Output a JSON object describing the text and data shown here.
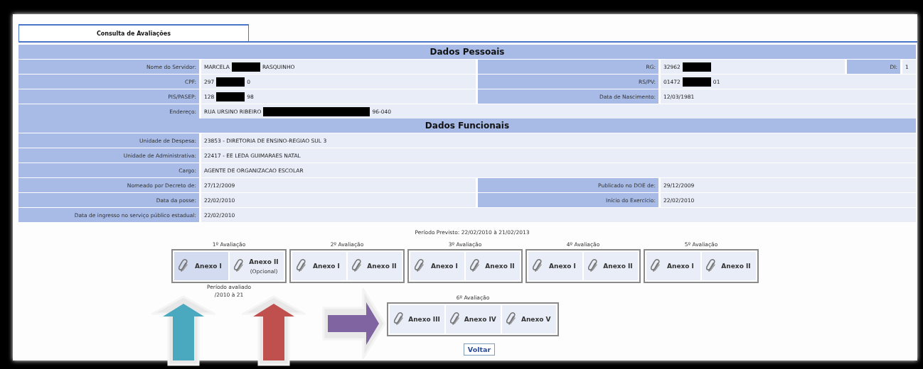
{
  "tab": {
    "label": "Consulta de Avaliações",
    "selected": true
  },
  "sections": [
    {
      "title": "Dados Pessoais",
      "rows": [
        {
          "fields": [
            {
              "label": "Nome do Servidor:",
              "segments": [
                {
                  "kind": "text",
                  "text": "MARCELA"
                },
                {
                  "kind": "redaction"
                },
                {
                  "kind": "text",
                  "text": "RASQUINHO"
                }
              ]
            },
            {
              "label": "RG:",
              "segments": [
                {
                  "kind": "text",
                  "text": "32962"
                },
                {
                  "kind": "redaction"
                }
              ]
            },
            {
              "label": "DI:",
              "segments": [
                {
                  "kind": "text",
                  "text": "1"
                }
              ]
            }
          ]
        },
        {
          "fields": [
            {
              "label": "CPF:",
              "segments": [
                {
                  "kind": "text",
                  "text": "297"
                },
                {
                  "kind": "redaction"
                },
                {
                  "kind": "text",
                  "text": "0"
                }
              ]
            },
            {
              "label": "RS/PV:",
              "segments": [
                {
                  "kind": "text",
                  "text": "01472"
                },
                {
                  "kind": "redaction"
                },
                {
                  "kind": "text",
                  "text": "01"
                }
              ]
            }
          ]
        },
        {
          "fields": [
            {
              "label": "PIS/PASEP:",
              "segments": [
                {
                  "kind": "text",
                  "text": "128"
                },
                {
                  "kind": "redaction"
                },
                {
                  "kind": "text",
                  "text": "98"
                }
              ]
            },
            {
              "label": "Data de Nascimento:",
              "segments": [
                {
                  "kind": "text",
                  "text": "12/03/1981"
                }
              ]
            }
          ]
        },
        {
          "fields": [
            {
              "label": "Endereço:",
              "segments": [
                {
                  "kind": "text",
                  "text": "RUA URSINO RIBEIRO"
                },
                {
                  "kind": "redaction"
                },
                {
                  "kind": "text",
                  "text": "96-040"
                }
              ]
            }
          ]
        }
      ]
    },
    {
      "title": "Dados Funcionais",
      "rows": [
        {
          "fields": [
            {
              "label": "Unidade de Despesa:",
              "segments": [
                {
                  "kind": "text",
                  "text": "23853 - DIRETORIA DE ENSINO-REGIAO SUL 3"
                }
              ]
            }
          ]
        },
        {
          "fields": [
            {
              "label": "Unidade de Administrativa:",
              "segments": [
                {
                  "kind": "text",
                  "text": "22417 - EE LEDA GUIMARAES NATAL"
                }
              ]
            }
          ]
        },
        {
          "fields": [
            {
              "label": "Cargo:",
              "segments": [
                {
                  "kind": "text",
                  "text": "AGENTE DE ORGANIZACAO ESCOLAR"
                }
              ]
            }
          ]
        },
        {
          "fields": [
            {
              "label": "Nomeado por Decreto de:",
              "segments": [
                {
                  "kind": "text",
                  "text": "27/12/2009"
                }
              ]
            },
            {
              "label": "Publicado no DOE de:",
              "segments": [
                {
                  "kind": "text",
                  "text": "29/12/2009"
                }
              ]
            }
          ]
        },
        {
          "fields": [
            {
              "label": "Data da posse:",
              "segments": [
                {
                  "kind": "text",
                  "text": "22/02/2010"
                }
              ]
            },
            {
              "label": "Início do Exercício:",
              "segments": [
                {
                  "kind": "text",
                  "text": "22/02/2010"
                }
              ]
            }
          ]
        },
        {
          "fields": [
            {
              "label": "Data de ingresso no serviço público estadual:",
              "segments": [
                {
                  "kind": "text",
                  "text": "22/02/2010"
                }
              ]
            }
          ]
        }
      ]
    }
  ],
  "period": "Período Previsto: 22/02/2010 à 21/02/2013",
  "evaluation_rows": [
    {
      "groups": [
        {
          "title": "1º Avaliação",
          "items": [
            {
              "label": "Anexo I",
              "selected": true
            },
            {
              "label": "Anexo II",
              "note": "(Opcional)",
              "selected": false
            }
          ],
          "caption": [
            "Período avaliado",
            "/2010 à 21"
          ]
        },
        {
          "title": "2º Avaliação",
          "items": [
            {
              "label": "Anexo I",
              "selected": false
            },
            {
              "label": "Anexo II",
              "selected": false
            }
          ]
        },
        {
          "title": "3º Avaliação",
          "items": [
            {
              "label": "Anexo I",
              "selected": false
            },
            {
              "label": "Anexo II",
              "selected": false
            }
          ]
        },
        {
          "title": "4º Avaliação",
          "items": [
            {
              "label": "Anexo I",
              "selected": false
            },
            {
              "label": "Anexo II",
              "selected": false
            }
          ]
        },
        {
          "title": "5º Avaliação",
          "items": [
            {
              "label": "Anexo I",
              "selected": false
            },
            {
              "label": "Anexo II",
              "selected": false
            }
          ]
        }
      ]
    },
    {
      "groups": [
        {
          "title": "6º Avaliação",
          "items": [
            {
              "label": "Anexo III",
              "selected": false
            },
            {
              "label": "Anexo IV",
              "selected": false
            },
            {
              "label": "Anexo V",
              "selected": false
            }
          ]
        }
      ]
    }
  ],
  "annotations": [
    {
      "kind": "up-arrow",
      "color": "#4aa8bf"
    },
    {
      "kind": "up-arrow",
      "color": "#c0504d"
    },
    {
      "kind": "right-arrow",
      "color": "#8064a2"
    }
  ],
  "back_button": "Voltar"
}
